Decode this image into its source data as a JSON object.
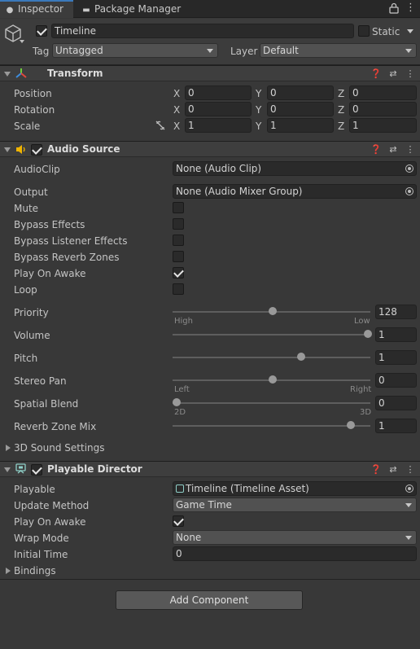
{
  "tabs": [
    {
      "label": "Inspector",
      "icon": "info-icon"
    },
    {
      "label": "Package Manager",
      "icon": "package-icon"
    }
  ],
  "header": {
    "name": "Timeline",
    "active": true,
    "static_label": "Static",
    "static": false,
    "tag_label": "Tag",
    "tag_value": "Untagged",
    "layer_label": "Layer",
    "layer_value": "Default"
  },
  "transform": {
    "title": "Transform",
    "axes": [
      "X",
      "Y",
      "Z"
    ],
    "rows": [
      {
        "label": "Position",
        "values": [
          "0",
          "0",
          "0"
        ]
      },
      {
        "label": "Rotation",
        "values": [
          "0",
          "0",
          "0"
        ]
      },
      {
        "label": "Scale",
        "values": [
          "1",
          "1",
          "1"
        ]
      }
    ]
  },
  "audio_source": {
    "title": "Audio Source",
    "enabled": true,
    "audio_clip_label": "AudioClip",
    "audio_clip_value": "None (Audio Clip)",
    "output_label": "Output",
    "output_value": "None (Audio Mixer Group)",
    "toggles": [
      {
        "label": "Mute",
        "checked": false
      },
      {
        "label": "Bypass Effects",
        "checked": false
      },
      {
        "label": "Bypass Listener Effects",
        "checked": false
      },
      {
        "label": "Bypass Reverb Zones",
        "checked": false
      },
      {
        "label": "Play On Awake",
        "checked": true
      },
      {
        "label": "Loop",
        "checked": false
      }
    ],
    "sliders": [
      {
        "label": "Priority",
        "value": "128",
        "fraction": 0.5,
        "min_label": "High",
        "max_label": "Low"
      },
      {
        "label": "Volume",
        "value": "1",
        "fraction": 1.0,
        "min_label": "",
        "max_label": ""
      },
      {
        "label": "Pitch",
        "value": "1",
        "fraction": 0.65,
        "min_label": "",
        "max_label": ""
      },
      {
        "label": "Stereo Pan",
        "value": "0",
        "fraction": 0.5,
        "min_label": "Left",
        "max_label": "Right"
      },
      {
        "label": "Spatial Blend",
        "value": "0",
        "fraction": 0.0,
        "min_label": "2D",
        "max_label": "3D"
      },
      {
        "label": "Reverb Zone Mix",
        "value": "1",
        "fraction": 0.91,
        "min_label": "",
        "max_label": ""
      }
    ],
    "sound_settings_label": "3D Sound Settings"
  },
  "playable_director": {
    "title": "Playable Director",
    "enabled": true,
    "playable_label": "Playable",
    "playable_value": "Timeline (Timeline Asset)",
    "update_method_label": "Update Method",
    "update_method_value": "Game Time",
    "play_on_awake_label": "Play On Awake",
    "play_on_awake": true,
    "wrap_mode_label": "Wrap Mode",
    "wrap_mode_value": "None",
    "initial_time_label": "Initial Time",
    "initial_time_value": "0",
    "bindings_label": "Bindings"
  },
  "add_component_label": "Add Component",
  "colors": {
    "background": "#383838",
    "field": "#2a2a2a",
    "header": "#3e3e3e",
    "accent": "#3a79bb",
    "audio_icon": "#f0b400"
  }
}
